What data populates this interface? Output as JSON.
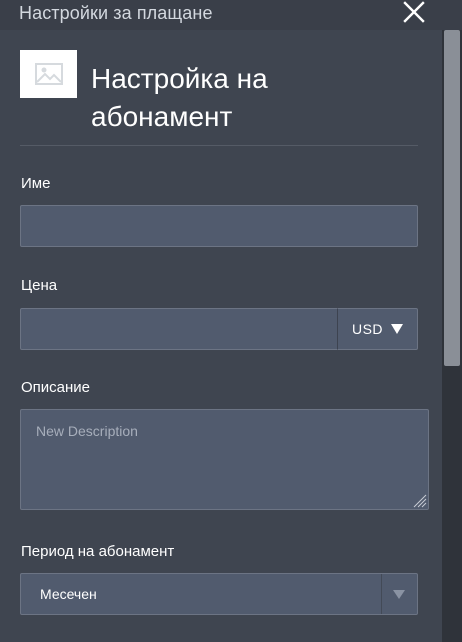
{
  "window": {
    "title": "Настройки за плащане",
    "close_icon": "close-icon"
  },
  "header": {
    "title": "Настройка на абонамент",
    "image_icon": "image-placeholder-icon"
  },
  "form": {
    "name": {
      "label": "Име",
      "value": ""
    },
    "price": {
      "label": "Цена",
      "value": "",
      "currency": "USD"
    },
    "description": {
      "label": "Описание",
      "value": "",
      "placeholder": "New Description"
    },
    "period": {
      "label": "Период на абонамент",
      "selected": "Месечен"
    }
  },
  "colors": {
    "panel_bg": "#3f4550",
    "input_bg": "#515b6e",
    "input_border": "#6c7484",
    "text": "#ffffff",
    "muted_text": "#a7aebb"
  }
}
